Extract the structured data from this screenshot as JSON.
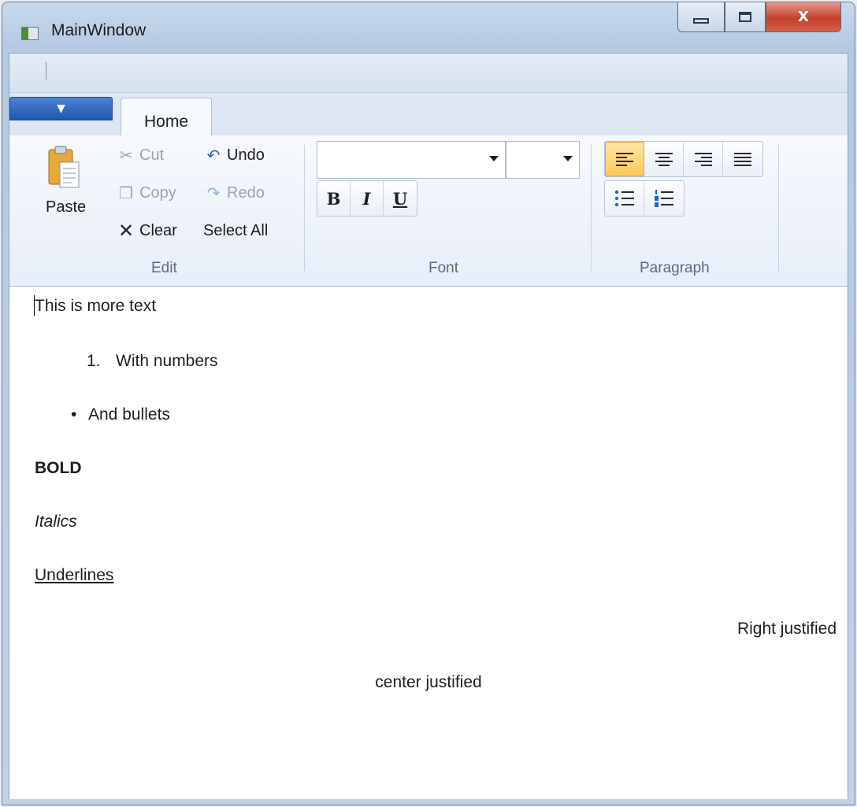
{
  "window": {
    "title": "MainWindow",
    "close_glyph": "X"
  },
  "app_menu": {
    "glyph": "▼"
  },
  "tabs": [
    {
      "label": "Home"
    }
  ],
  "ribbon": {
    "edit": {
      "label": "Edit",
      "paste": "Paste",
      "cut": "Cut",
      "copy": "Copy",
      "clear": "Clear",
      "undo": "Undo",
      "redo": "Redo",
      "select_all": "Select All"
    },
    "font": {
      "label": "Font",
      "family_value": "",
      "size_value": "",
      "bold": "B",
      "italic": "I",
      "underline": "U"
    },
    "paragraph": {
      "label": "Paragraph",
      "alignment_selected": "left"
    }
  },
  "document": {
    "line1": "This is more text",
    "numbered_marker": "1.",
    "numbered_text": "With numbers",
    "bullet_marker": "•",
    "bullet_text": "And bullets",
    "bold": "BOLD",
    "italics": "Italics",
    "underlines": "Underlines",
    "right": "Right justified",
    "center": "center justified"
  },
  "colors": {
    "accent_active": "#ffc85a",
    "app_menu": "#1f58b2",
    "close_button": "#c3412c"
  }
}
